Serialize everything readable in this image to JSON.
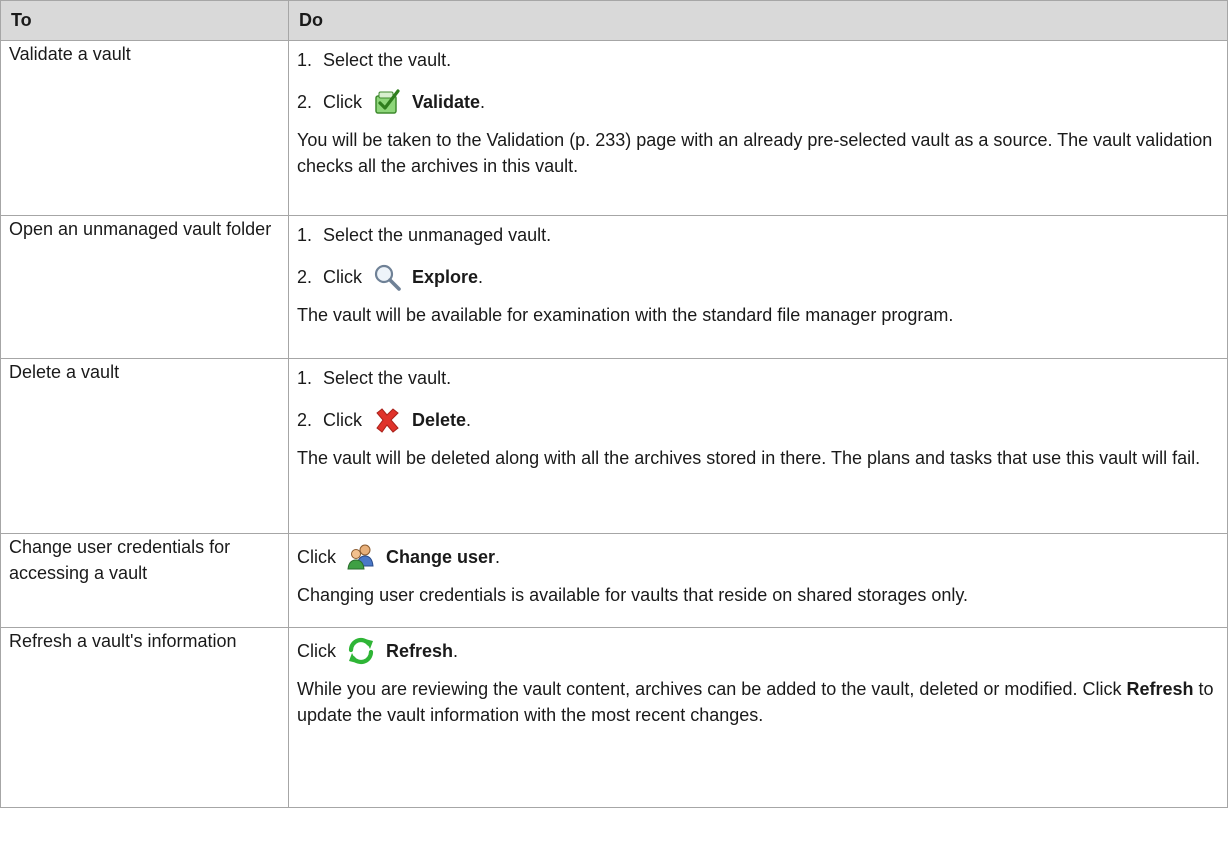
{
  "header": {
    "col_to": "To",
    "col_do": "Do"
  },
  "rows": [
    {
      "task": "Validate a vault",
      "step1_num": "1.",
      "step1": "Select the vault.",
      "step2_num": "2.",
      "click": "Click",
      "action": "Validate",
      "period": ".",
      "icon": "validate-checkmark-icon",
      "note": "You will be taken to the Validation (p. 233) page with an already pre-selected vault as a source. The vault validation checks all the archives in this vault."
    },
    {
      "task": "Open an unmanaged vault folder",
      "step1_num": "1.",
      "step1": "Select the unmanaged vault.",
      "step2_num": "2.",
      "click": "Click",
      "action": "Explore",
      "period": ".",
      "icon": "magnifier-icon",
      "note": "The vault will be available for examination with the standard file manager program."
    },
    {
      "task": "Delete a vault",
      "step1_num": "1.",
      "step1": "Select the vault.",
      "step2_num": "2.",
      "click": "Click",
      "action": "Delete",
      "period": ".",
      "icon": "delete-x-icon",
      "note": "The vault will be deleted along with all the archives stored in there. The plans and tasks that use this vault will fail."
    },
    {
      "task": "Change user credentials for accessing a vault",
      "click": "Click",
      "action": "Change user",
      "period": ".",
      "icon": "change-user-icon",
      "note": "Changing user credentials is available for vaults that reside on shared storages only."
    },
    {
      "task": "Refresh a vault's information",
      "click": "Click",
      "action": "Refresh",
      "period": ".",
      "icon": "refresh-icon",
      "note_a": "While you are reviewing the vault content, archives can be added to the vault, deleted or modified. Click ",
      "note_bold": "Refresh",
      "note_b": " to update the vault information with the most recent changes."
    }
  ],
  "colors": {
    "header_bg": "#d9d9d9",
    "border": "#a6a6a6",
    "text": "#1a1a1a",
    "delete_red": "#e0332b",
    "refresh_green": "#2fb536"
  }
}
